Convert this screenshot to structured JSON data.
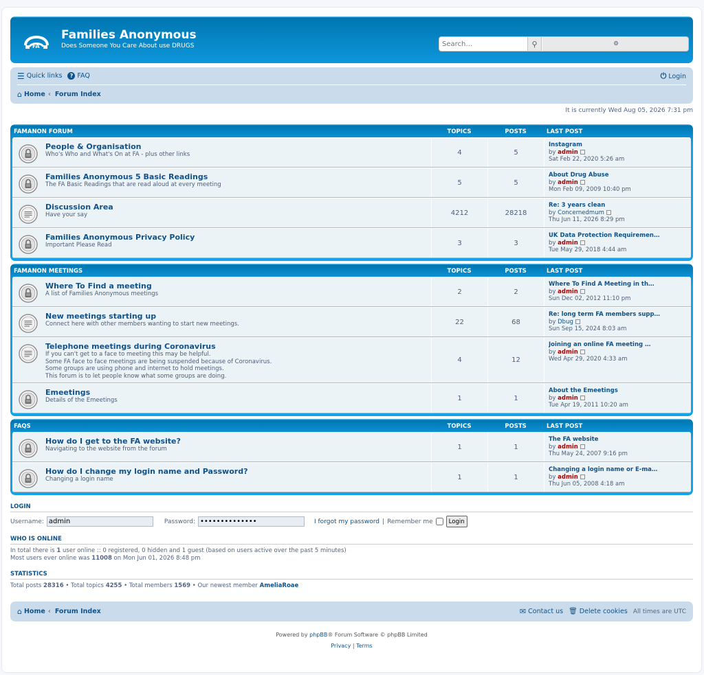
{
  "header": {
    "title": "Families Anonymous",
    "description": "Does Someone You Care About use DRUGS",
    "search_placeholder": "Search…"
  },
  "nav": {
    "quick_links": "Quick links",
    "faq": "FAQ",
    "login": "Login",
    "home": "Home",
    "forum_index": "Forum Index"
  },
  "current_time": "It is currently Wed Aug 05, 2026 7:31 pm",
  "columns": {
    "topics": "TOPICS",
    "posts": "POSTS",
    "last_post": "LAST POST"
  },
  "categories": [
    {
      "title": "FAMANON FORUM",
      "forums": [
        {
          "name": "People & Organisation",
          "desc": "Who's Who and What's On at FA - plus other links",
          "topics": "4",
          "posts": "5",
          "last_title": "Instagram",
          "by": "by",
          "author": "admin",
          "date": "Sat Feb 22, 2020 5:26 am",
          "icon": "lock-icon"
        },
        {
          "name": "Families Anonymous 5 Basic Readings",
          "desc": "The FA Basic Readings that are read aloud at every meeting",
          "topics": "5",
          "posts": "5",
          "last_title": "About Drug Abuse",
          "by": "by",
          "author": "admin",
          "date": "Mon Feb 09, 2009 10:40 pm",
          "icon": "lock-icon"
        },
        {
          "name": "Discussion Area",
          "desc": "Have your say",
          "topics": "4212",
          "posts": "28218",
          "last_title": "Re: 3 years clean",
          "by": "by",
          "author": "Concernedmum",
          "date": "Thu Jun 11, 2026 8:29 pm",
          "icon": "forum-icon"
        },
        {
          "name": "Families Anonymous Privacy Policy",
          "desc": "Important Please Read",
          "topics": "3",
          "posts": "3",
          "last_title": "UK Data Protection Requiremen…",
          "by": "by",
          "author": "admin",
          "date": "Tue May 29, 2018 4:44 am",
          "icon": "lock-icon"
        }
      ]
    },
    {
      "title": "FAMANON MEETINGS",
      "forums": [
        {
          "name": "Where To Find a meeting",
          "desc": "A list of Families Anonymous meetings",
          "topics": "2",
          "posts": "2",
          "last_title": "Where To Find A Meeting in th…",
          "by": "by",
          "author": "admin",
          "date": "Sun Dec 02, 2012 11:10 pm",
          "icon": "lock-icon"
        },
        {
          "name": "New meetings starting up",
          "desc": "Connect here with other members wanting to start new meetings.",
          "topics": "22",
          "posts": "68",
          "last_title": "Re: long term FA members supp…",
          "by": "by",
          "author": "Dbug",
          "date": "Sun Sep 15, 2024 8:03 am",
          "icon": "forum-icon"
        },
        {
          "name": "Telephone meetings during Coronavirus",
          "desc": "If you can't get to a face to meeting this may be helpful.\nSome FA face to face meetings are being suspended because of Coronavirus.\nSome groups are using phone and internet to hold meetings.\nThis forum is to let people know what some groups are doing.",
          "topics": "4",
          "posts": "12",
          "last_title": "Joining an online FA meeting …",
          "by": "by",
          "author": "admin",
          "date": "Wed Apr 29, 2020 4:33 am",
          "icon": "forum-icon"
        },
        {
          "name": "Emeetings",
          "desc": "Details of the Emeetings",
          "topics": "1",
          "posts": "1",
          "last_title": "About the Emeetings",
          "by": "by",
          "author": "admin",
          "date": "Tue Apr 19, 2011 10:20 am",
          "icon": "lock-icon"
        }
      ]
    },
    {
      "title": "FAQS",
      "forums": [
        {
          "name": "How do I get to the FA website?",
          "desc": "Navigating to the website from the forum",
          "topics": "1",
          "posts": "1",
          "last_title": "The FA website",
          "by": "by",
          "author": "admin",
          "date": "Thu May 24, 2007 9:16 pm",
          "icon": "lock-icon"
        },
        {
          "name": "How do I change my login name and Password?",
          "desc": "Changing a login name",
          "topics": "1",
          "posts": "1",
          "last_title": "Changing a login name or E-ma…",
          "by": "by",
          "author": "admin",
          "date": "Thu Jun 05, 2008 4:18 am",
          "icon": "lock-icon"
        }
      ]
    }
  ],
  "login": {
    "heading": "LOGIN",
    "username_label": "Username:",
    "username_value": "admin",
    "password_label": "Password:",
    "password_value": "••••••••••••••",
    "forgot": "I forgot my password",
    "remember": "Remember me",
    "button": "Login"
  },
  "online": {
    "heading": "WHO IS ONLINE",
    "line1_pre": "In total there is ",
    "line1_count": "1",
    "line1_post": " user online :: 0 registered, 0 hidden and 1 guest (based on users active over the past 5 minutes)",
    "line2_pre": "Most users ever online was ",
    "line2_count": "11008",
    "line2_post": " on Mon Jun 01, 2026 8:48 pm"
  },
  "stats": {
    "heading": "STATISTICS",
    "posts_label": "Total posts ",
    "posts": "28316",
    "topics_label": " • Total topics ",
    "topics": "4255",
    "members_label": " • Total members ",
    "members": "1569",
    "newest_label": " • Our newest member ",
    "newest": "AmeliaRoae"
  },
  "footnav": {
    "home": "Home",
    "forum_index": "Forum Index",
    "contact": "Contact us",
    "delete_cookies": "Delete cookies",
    "timezone": "All times are UTC"
  },
  "footer": {
    "powered_pre": "Powered by ",
    "phpbb": "phpBB",
    "powered_post": "® Forum Software © phpBB Limited",
    "privacy": "Privacy",
    "sep": " | ",
    "terms": "Terms"
  }
}
